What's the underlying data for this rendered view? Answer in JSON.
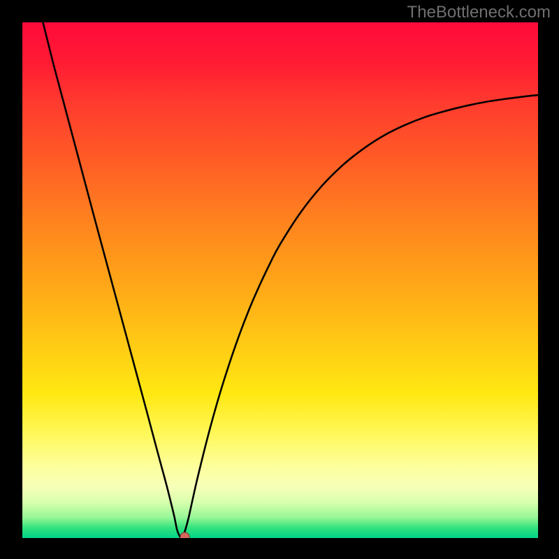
{
  "attribution": "TheBottleneck.com",
  "colors": {
    "curve_stroke": "#000000",
    "marker_fill": "#d46a5e",
    "marker_stroke": "#8a3a32",
    "frame": "#000000"
  },
  "chart_data": {
    "type": "line",
    "title": "",
    "xlabel": "",
    "ylabel": "",
    "xlim": [
      0,
      100
    ],
    "ylim": [
      0,
      100
    ],
    "grid": false,
    "legend": false,
    "x": [
      4,
      6,
      8,
      10,
      12,
      14,
      16,
      18,
      20,
      22,
      24,
      26,
      27,
      28,
      29,
      29.5,
      30,
      30.5,
      31,
      32,
      33,
      34,
      36,
      38,
      40,
      42,
      44,
      46,
      48,
      50,
      54,
      58,
      62,
      66,
      70,
      74,
      78,
      82,
      86,
      90,
      94,
      98,
      100
    ],
    "values": [
      100,
      92,
      84.5,
      77,
      69.5,
      62,
      54.6,
      47.2,
      39.8,
      32.4,
      25,
      17.5,
      13.8,
      10.1,
      6.1,
      4.0,
      1.6,
      0.4,
      0.0,
      3.0,
      7.4,
      11.8,
      19.8,
      27.0,
      33.4,
      39.2,
      44.4,
      49.0,
      53.2,
      57.0,
      63.2,
      68.2,
      72.2,
      75.4,
      78.0,
      80.0,
      81.6,
      82.8,
      83.8,
      84.6,
      85.2,
      85.7,
      85.9
    ],
    "marker": {
      "x": 31.5,
      "y": 0.2
    },
    "annotations": []
  }
}
